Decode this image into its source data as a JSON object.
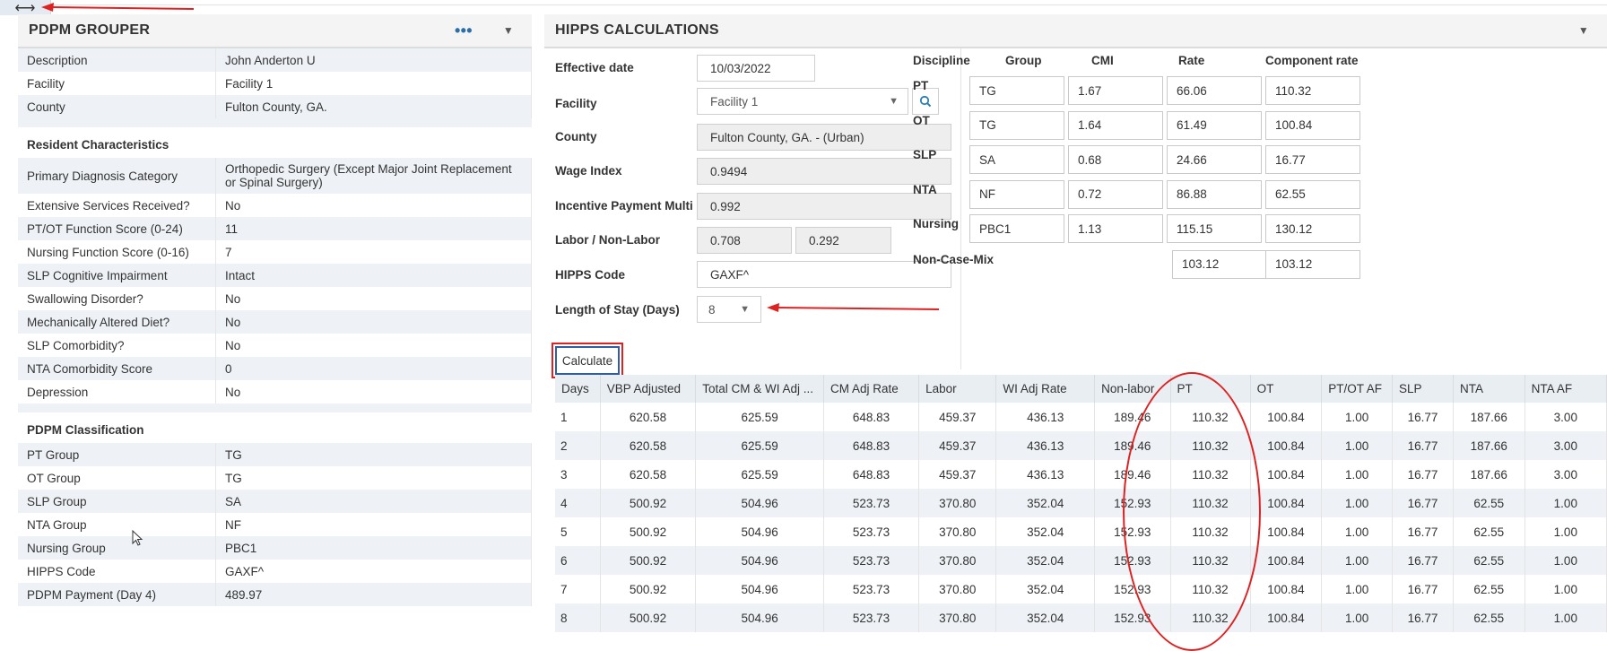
{
  "resize_icon": "⟷",
  "left": {
    "title": "PDPM GROUPER",
    "menu_icon": "•••",
    "collapse_icon": "▼",
    "rows_top": [
      {
        "label": "Description",
        "value": "John Anderton U"
      },
      {
        "label": "Facility",
        "value": "Facility 1"
      },
      {
        "label": "County",
        "value": "Fulton County, GA."
      }
    ],
    "section_resident": "Resident Characteristics",
    "rows_resident": [
      {
        "label": "Primary Diagnosis Category",
        "value": "Orthopedic Surgery (Except Major Joint Replacement or Spinal Surgery)"
      },
      {
        "label": "Extensive Services Received?",
        "value": "No"
      },
      {
        "label": "PT/OT Function Score (0-24)",
        "value": "11"
      },
      {
        "label": "Nursing Function Score (0-16)",
        "value": "7"
      },
      {
        "label": "SLP Cognitive Impairment",
        "value": "Intact"
      },
      {
        "label": "Swallowing Disorder?",
        "value": "No"
      },
      {
        "label": "Mechanically Altered Diet?",
        "value": "No"
      },
      {
        "label": "SLP Comorbidity?",
        "value": "No"
      },
      {
        "label": "NTA Comorbidity Score",
        "value": "0"
      },
      {
        "label": "Depression",
        "value": "No"
      }
    ],
    "section_classification": "PDPM Classification",
    "rows_classification": [
      {
        "label": "PT Group",
        "value": "TG"
      },
      {
        "label": "OT Group",
        "value": "TG"
      },
      {
        "label": "SLP Group",
        "value": "SA"
      },
      {
        "label": "NTA Group",
        "value": "NF"
      },
      {
        "label": "Nursing Group",
        "value": "PBC1"
      },
      {
        "label": "HIPPS Code",
        "value": "GAXF^"
      },
      {
        "label": "PDPM Payment (Day 4)",
        "value": "489.97"
      }
    ]
  },
  "right": {
    "title": "HIPPS CALCULATIONS",
    "collapse_icon": "▼",
    "form": {
      "effective_date_label": "Effective date",
      "effective_date": "10/03/2022",
      "facility_label": "Facility",
      "facility": "Facility 1",
      "county_label": "County",
      "county": "Fulton County, GA. - (Urban)",
      "wage_index_label": "Wage Index",
      "wage_index": "0.9494",
      "incentive_label": "Incentive Payment Multi",
      "incentive": "0.992",
      "labor_label": "Labor / Non-Labor",
      "labor": "0.708",
      "non_labor": "0.292",
      "hipps_label": "HIPPS Code",
      "hipps": "GAXF^",
      "los_label": "Length of Stay (Days)",
      "los": "8",
      "calculate_label": "Calculate"
    },
    "disciplines": {
      "headers": [
        "Discipline",
        "Group",
        "CMI",
        "Rate",
        "Component rate"
      ],
      "rows": [
        {
          "name": "PT",
          "group": "TG",
          "cmi": "1.67",
          "rate": "66.06",
          "component": "110.32"
        },
        {
          "name": "OT",
          "group": "TG",
          "cmi": "1.64",
          "rate": "61.49",
          "component": "100.84"
        },
        {
          "name": "SLP",
          "group": "SA",
          "cmi": "0.68",
          "rate": "24.66",
          "component": "16.77"
        },
        {
          "name": "NTA",
          "group": "NF",
          "cmi": "0.72",
          "rate": "86.88",
          "component": "62.55"
        },
        {
          "name": "Nursing",
          "group": "PBC1",
          "cmi": "1.13",
          "rate": "115.15",
          "component": "130.12"
        }
      ],
      "non_case_mix_label": "Non-Case-Mix",
      "non_case_mix_rate": "103.12",
      "non_case_mix_component": "103.12"
    },
    "grid": {
      "columns": [
        "Days",
        "VBP Adjusted",
        "Total CM & WI Adj ...",
        "CM Adj Rate",
        "Labor",
        "WI Adj Rate",
        "Non-labor",
        "PT",
        "OT",
        "PT/OT AF",
        "SLP",
        "NTA",
        "NTA AF"
      ],
      "rows": [
        [
          "1",
          "620.58",
          "625.59",
          "648.83",
          "459.37",
          "436.13",
          "189.46",
          "110.32",
          "100.84",
          "1.00",
          "16.77",
          "187.66",
          "3.00"
        ],
        [
          "2",
          "620.58",
          "625.59",
          "648.83",
          "459.37",
          "436.13",
          "189.46",
          "110.32",
          "100.84",
          "1.00",
          "16.77",
          "187.66",
          "3.00"
        ],
        [
          "3",
          "620.58",
          "625.59",
          "648.83",
          "459.37",
          "436.13",
          "189.46",
          "110.32",
          "100.84",
          "1.00",
          "16.77",
          "187.66",
          "3.00"
        ],
        [
          "4",
          "500.92",
          "504.96",
          "523.73",
          "370.80",
          "352.04",
          "152.93",
          "110.32",
          "100.84",
          "1.00",
          "16.77",
          "62.55",
          "1.00"
        ],
        [
          "5",
          "500.92",
          "504.96",
          "523.73",
          "370.80",
          "352.04",
          "152.93",
          "110.32",
          "100.84",
          "1.00",
          "16.77",
          "62.55",
          "1.00"
        ],
        [
          "6",
          "500.92",
          "504.96",
          "523.73",
          "370.80",
          "352.04",
          "152.93",
          "110.32",
          "100.84",
          "1.00",
          "16.77",
          "62.55",
          "1.00"
        ],
        [
          "7",
          "500.92",
          "504.96",
          "523.73",
          "370.80",
          "352.04",
          "152.93",
          "110.32",
          "100.84",
          "1.00",
          "16.77",
          "62.55",
          "1.00"
        ],
        [
          "8",
          "500.92",
          "504.96",
          "523.73",
          "370.80",
          "352.04",
          "152.93",
          "110.32",
          "100.84",
          "1.00",
          "16.77",
          "62.55",
          "1.00"
        ]
      ]
    }
  },
  "colors": {
    "annotation_red": "#dd2222",
    "button_border": "#2f5fa0",
    "grid_header": "#e9eef3",
    "row_alt": "#eef2f6"
  }
}
